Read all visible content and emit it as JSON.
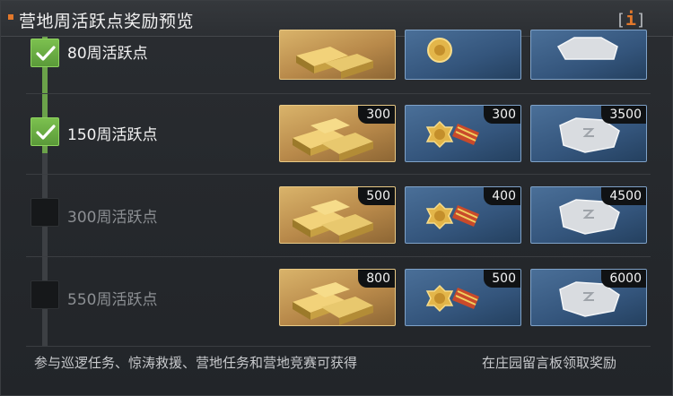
{
  "header": {
    "title": "营地周活跃点奖励预览",
    "info_label": "i"
  },
  "tiers": [
    {
      "label": "80周活跃点",
      "completed": true,
      "rewards": [
        {
          "type": "gold-bars",
          "amount": ""
        },
        {
          "type": "medal",
          "amount": ""
        },
        {
          "type": "silver-stone",
          "amount": ""
        }
      ]
    },
    {
      "label": "150周活跃点",
      "completed": true,
      "rewards": [
        {
          "type": "gold-bars",
          "amount": "300"
        },
        {
          "type": "medal",
          "amount": "300"
        },
        {
          "type": "silver-stone",
          "amount": "3500"
        }
      ]
    },
    {
      "label": "300周活跃点",
      "completed": false,
      "rewards": [
        {
          "type": "gold-bars",
          "amount": "500"
        },
        {
          "type": "medal",
          "amount": "400"
        },
        {
          "type": "silver-stone",
          "amount": "4500"
        }
      ]
    },
    {
      "label": "550周活跃点",
      "completed": false,
      "rewards": [
        {
          "type": "gold-bars",
          "amount": "800"
        },
        {
          "type": "medal",
          "amount": "500"
        },
        {
          "type": "silver-stone",
          "amount": "6000"
        }
      ]
    }
  ],
  "footer": {
    "left_text": "参与巡逻任务、惊涛救援、营地任务和营地竞赛可获得",
    "right_text": "在庄园留言板领取奖励"
  },
  "colors": {
    "accent": "#e2782b",
    "check_green": "#6ba24a",
    "gold_card": "#c99a55",
    "blue_card": "#3a5b82"
  }
}
